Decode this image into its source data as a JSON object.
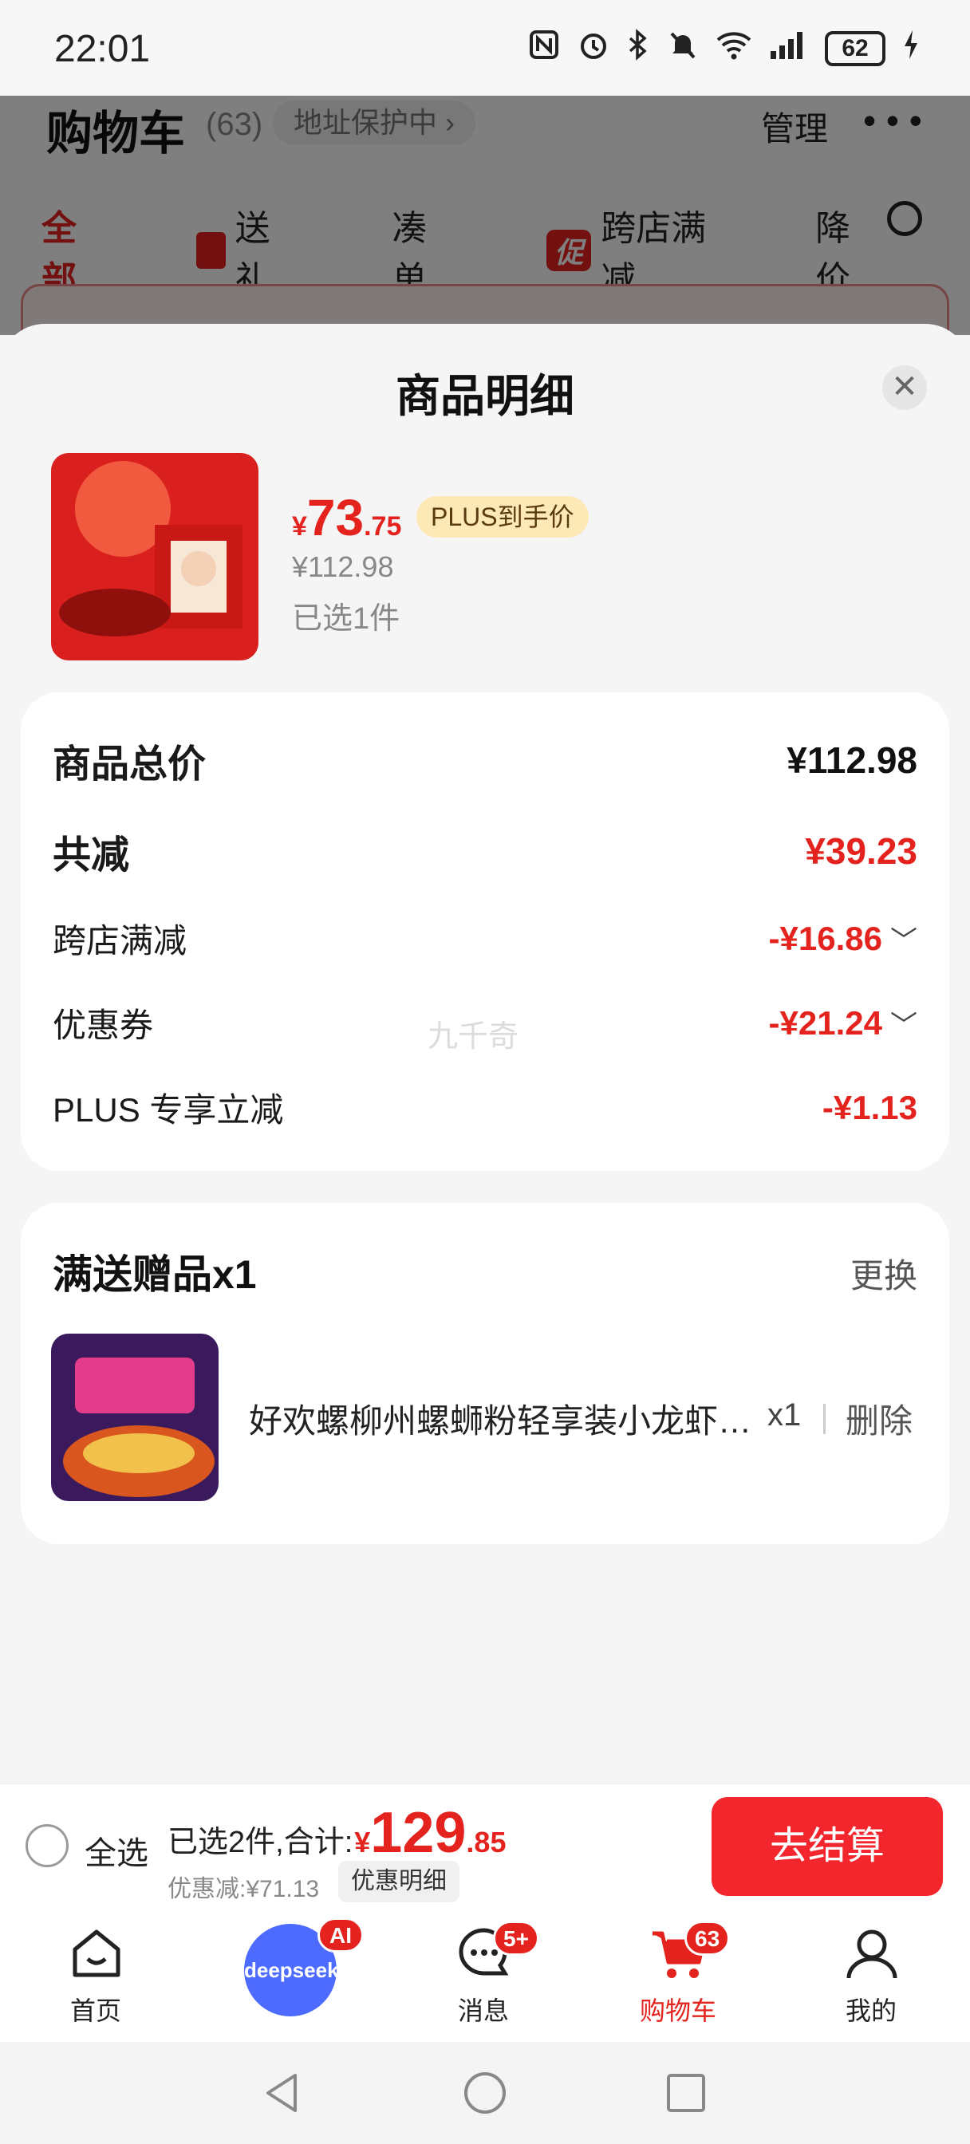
{
  "status_bar": {
    "time": "22:01",
    "battery": "62"
  },
  "background": {
    "cart_title": "购物车",
    "cart_count": "(63)",
    "address_chip": "地址保护中 ›",
    "manage": "管理",
    "filters": [
      "全部",
      "送礼",
      "凑单",
      "跨店满减",
      "降价"
    ],
    "promo_badge": "促"
  },
  "sheet": {
    "title": "商品明细",
    "product": {
      "price_symbol": "¥",
      "price_int": "73",
      "price_dec": ".75",
      "plus_tag": "PLUS到手价",
      "original_price": "¥112.98",
      "selected": "已选1件"
    },
    "summary": {
      "total_label": "商品总价",
      "total_value": "¥112.98",
      "reduce_label": "共减",
      "reduce_value": "¥39.23",
      "items": [
        {
          "label": "跨店满减",
          "value": "-¥16.86"
        },
        {
          "label": "优惠券",
          "value": "-¥21.24"
        },
        {
          "label": "PLUS 专享立减",
          "value": "-¥1.13"
        }
      ],
      "watermark": "九千奇"
    },
    "gift": {
      "title": "满送赠品x1",
      "change": "更换",
      "name": "好欢螺柳州螺蛳粉轻享装小龙虾味螺蛳粉",
      "qty": "x1",
      "delete": "删除"
    }
  },
  "checkout": {
    "select_all": "全选",
    "selected_text": "已选2件,合计:",
    "total_symbol": "¥",
    "total_int": "129",
    "total_dec": ".85",
    "discount": "优惠减:¥71.13",
    "detail_btn": "优惠明细",
    "pay_btn": "去结算"
  },
  "bottom_nav": {
    "home": "首页",
    "deepseek": "deepseek",
    "ai_badge": "AI",
    "messages": "消息",
    "messages_badge": "5+",
    "cart": "购物车",
    "cart_badge": "63",
    "me": "我的"
  },
  "colors": {
    "accent": "#e4231e",
    "plus_chip": "#fde9b6",
    "deepseek": "#4d6bfe"
  }
}
